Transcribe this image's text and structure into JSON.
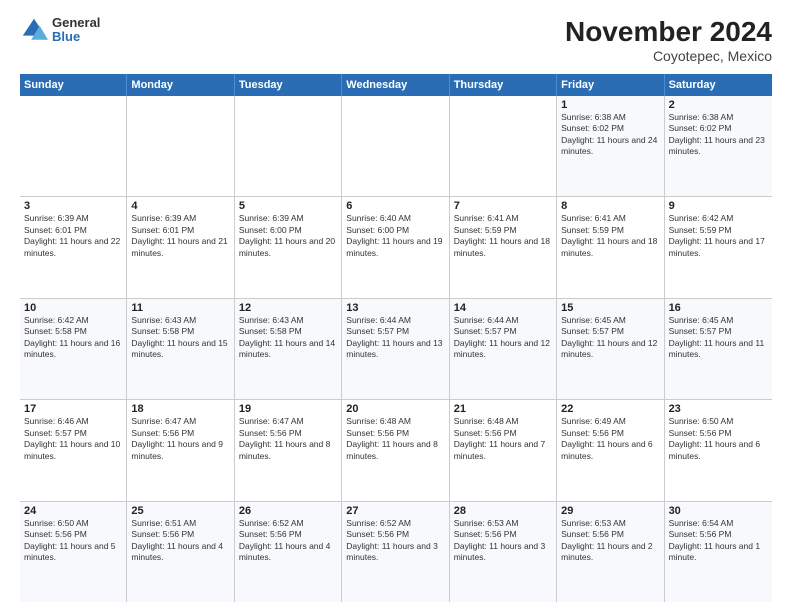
{
  "header": {
    "logo": {
      "general": "General",
      "blue": "Blue"
    },
    "title": "November 2024",
    "subtitle": "Coyotepec, Mexico"
  },
  "days": [
    "Sunday",
    "Monday",
    "Tuesday",
    "Wednesday",
    "Thursday",
    "Friday",
    "Saturday"
  ],
  "weeks": [
    [
      {
        "day": "",
        "text": ""
      },
      {
        "day": "",
        "text": ""
      },
      {
        "day": "",
        "text": ""
      },
      {
        "day": "",
        "text": ""
      },
      {
        "day": "",
        "text": ""
      },
      {
        "day": "1",
        "text": "Sunrise: 6:38 AM\nSunset: 6:02 PM\nDaylight: 11 hours and 24 minutes."
      },
      {
        "day": "2",
        "text": "Sunrise: 6:38 AM\nSunset: 6:02 PM\nDaylight: 11 hours and 23 minutes."
      }
    ],
    [
      {
        "day": "3",
        "text": "Sunrise: 6:39 AM\nSunset: 6:01 PM\nDaylight: 11 hours and 22 minutes."
      },
      {
        "day": "4",
        "text": "Sunrise: 6:39 AM\nSunset: 6:01 PM\nDaylight: 11 hours and 21 minutes."
      },
      {
        "day": "5",
        "text": "Sunrise: 6:39 AM\nSunset: 6:00 PM\nDaylight: 11 hours and 20 minutes."
      },
      {
        "day": "6",
        "text": "Sunrise: 6:40 AM\nSunset: 6:00 PM\nDaylight: 11 hours and 19 minutes."
      },
      {
        "day": "7",
        "text": "Sunrise: 6:41 AM\nSunset: 5:59 PM\nDaylight: 11 hours and 18 minutes."
      },
      {
        "day": "8",
        "text": "Sunrise: 6:41 AM\nSunset: 5:59 PM\nDaylight: 11 hours and 18 minutes."
      },
      {
        "day": "9",
        "text": "Sunrise: 6:42 AM\nSunset: 5:59 PM\nDaylight: 11 hours and 17 minutes."
      }
    ],
    [
      {
        "day": "10",
        "text": "Sunrise: 6:42 AM\nSunset: 5:58 PM\nDaylight: 11 hours and 16 minutes."
      },
      {
        "day": "11",
        "text": "Sunrise: 6:43 AM\nSunset: 5:58 PM\nDaylight: 11 hours and 15 minutes."
      },
      {
        "day": "12",
        "text": "Sunrise: 6:43 AM\nSunset: 5:58 PM\nDaylight: 11 hours and 14 minutes."
      },
      {
        "day": "13",
        "text": "Sunrise: 6:44 AM\nSunset: 5:57 PM\nDaylight: 11 hours and 13 minutes."
      },
      {
        "day": "14",
        "text": "Sunrise: 6:44 AM\nSunset: 5:57 PM\nDaylight: 11 hours and 12 minutes."
      },
      {
        "day": "15",
        "text": "Sunrise: 6:45 AM\nSunset: 5:57 PM\nDaylight: 11 hours and 12 minutes."
      },
      {
        "day": "16",
        "text": "Sunrise: 6:45 AM\nSunset: 5:57 PM\nDaylight: 11 hours and 11 minutes."
      }
    ],
    [
      {
        "day": "17",
        "text": "Sunrise: 6:46 AM\nSunset: 5:57 PM\nDaylight: 11 hours and 10 minutes."
      },
      {
        "day": "18",
        "text": "Sunrise: 6:47 AM\nSunset: 5:56 PM\nDaylight: 11 hours and 9 minutes."
      },
      {
        "day": "19",
        "text": "Sunrise: 6:47 AM\nSunset: 5:56 PM\nDaylight: 11 hours and 8 minutes."
      },
      {
        "day": "20",
        "text": "Sunrise: 6:48 AM\nSunset: 5:56 PM\nDaylight: 11 hours and 8 minutes."
      },
      {
        "day": "21",
        "text": "Sunrise: 6:48 AM\nSunset: 5:56 PM\nDaylight: 11 hours and 7 minutes."
      },
      {
        "day": "22",
        "text": "Sunrise: 6:49 AM\nSunset: 5:56 PM\nDaylight: 11 hours and 6 minutes."
      },
      {
        "day": "23",
        "text": "Sunrise: 6:50 AM\nSunset: 5:56 PM\nDaylight: 11 hours and 6 minutes."
      }
    ],
    [
      {
        "day": "24",
        "text": "Sunrise: 6:50 AM\nSunset: 5:56 PM\nDaylight: 11 hours and 5 minutes."
      },
      {
        "day": "25",
        "text": "Sunrise: 6:51 AM\nSunset: 5:56 PM\nDaylight: 11 hours and 4 minutes."
      },
      {
        "day": "26",
        "text": "Sunrise: 6:52 AM\nSunset: 5:56 PM\nDaylight: 11 hours and 4 minutes."
      },
      {
        "day": "27",
        "text": "Sunrise: 6:52 AM\nSunset: 5:56 PM\nDaylight: 11 hours and 3 minutes."
      },
      {
        "day": "28",
        "text": "Sunrise: 6:53 AM\nSunset: 5:56 PM\nDaylight: 11 hours and 3 minutes."
      },
      {
        "day": "29",
        "text": "Sunrise: 6:53 AM\nSunset: 5:56 PM\nDaylight: 11 hours and 2 minutes."
      },
      {
        "day": "30",
        "text": "Sunrise: 6:54 AM\nSunset: 5:56 PM\nDaylight: 11 hours and 1 minute."
      }
    ]
  ]
}
